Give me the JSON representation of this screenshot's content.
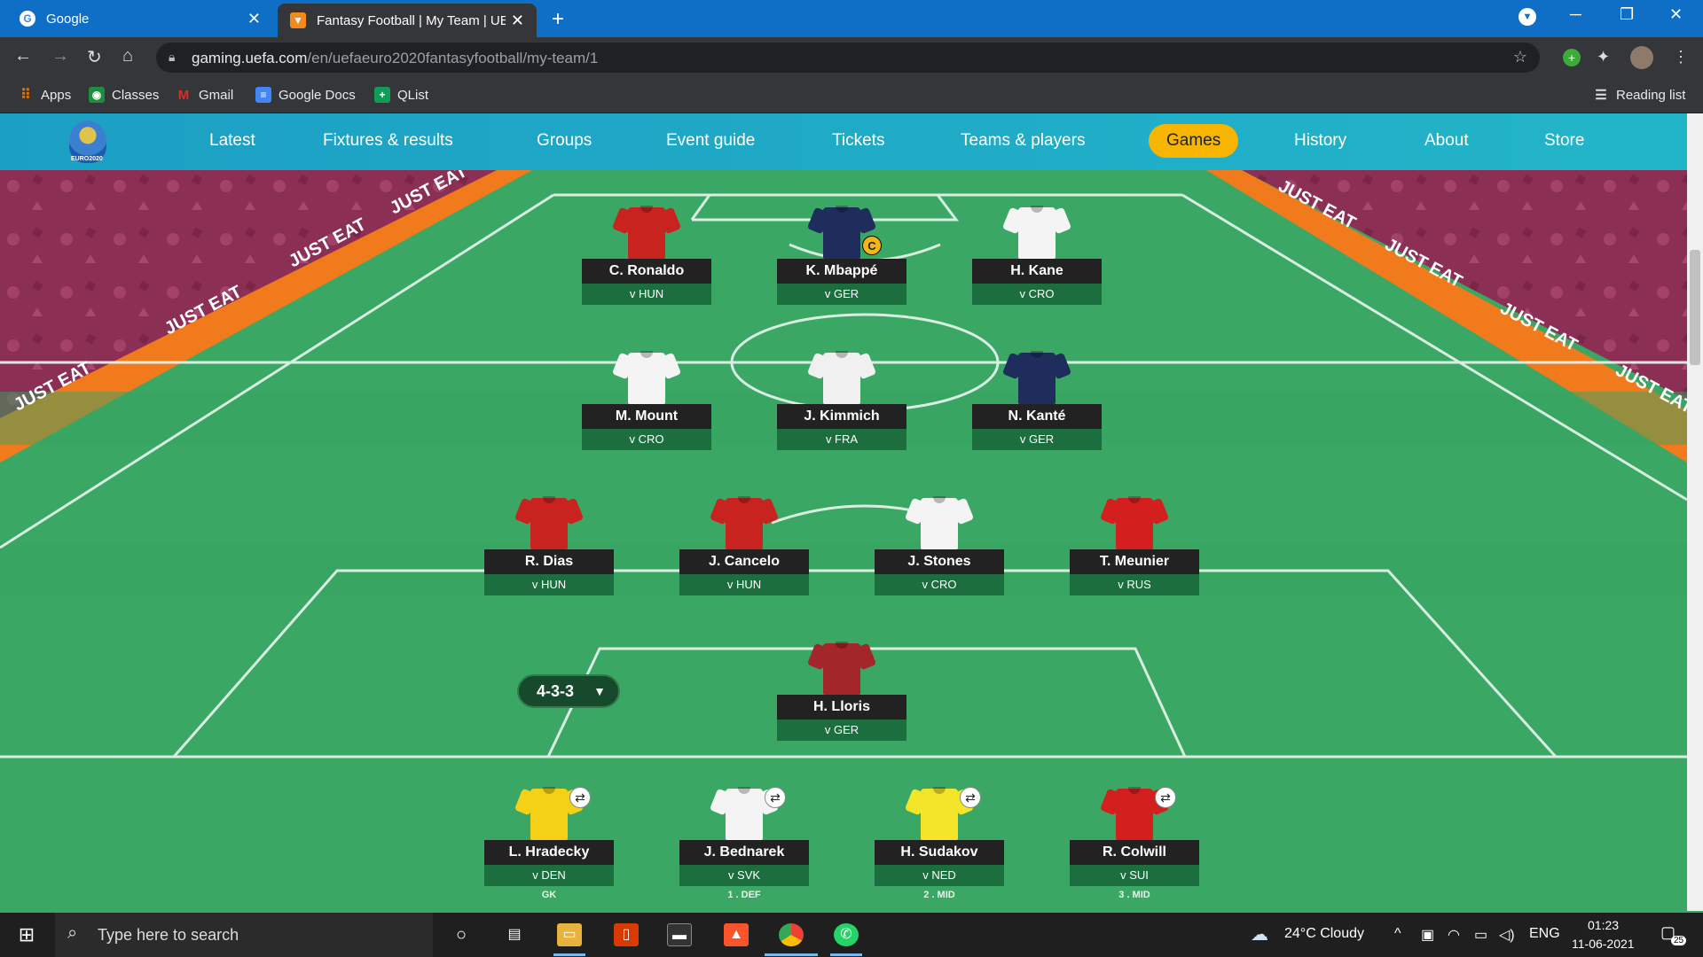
{
  "browser": {
    "tabs": [
      {
        "title": "Google",
        "active": false
      },
      {
        "title": "Fantasy Football | My Team | UEFA",
        "active": true
      }
    ],
    "new_tab_symbol": "+",
    "url_host": "gaming.uefa.com",
    "url_path": "/en/uefaeuro2020fantasyfootball/my-team/1",
    "bookmarks": [
      {
        "label": "Apps",
        "icon": "apps-grid-icon",
        "color": "#e8710a"
      },
      {
        "label": "Classes",
        "icon": "classes-icon",
        "color": "#1e8e3e"
      },
      {
        "label": "Gmail",
        "icon": "gmail-icon",
        "color": "#d93025"
      },
      {
        "label": "Google Docs",
        "icon": "docs-icon",
        "color": "#4285f4"
      },
      {
        "label": "QList",
        "icon": "qlist-icon",
        "color": "#0f9d58"
      }
    ],
    "reading_list": "Reading list"
  },
  "site": {
    "logo_text": "EURO2020",
    "nav": [
      "Latest",
      "Fixtures & results",
      "Groups",
      "Event guide",
      "Tickets",
      "Teams & players",
      "Games",
      "History",
      "About",
      "Store"
    ],
    "active_nav": "Games"
  },
  "team": {
    "formation": "4-3-3",
    "captain_mark": "C",
    "forwards": [
      {
        "name": "C. Ronaldo",
        "fixture": "v HUN",
        "shirt": "#c8231f",
        "sleeve": "#c8231f"
      },
      {
        "name": "K. Mbappé",
        "fixture": "v GER",
        "shirt": "#1f2d5c",
        "sleeve": "#1f2d5c",
        "captain": true
      },
      {
        "name": "H. Kane",
        "fixture": "v CRO",
        "shirt": "#f4f4f4",
        "sleeve": "#f4f4f4"
      }
    ],
    "midfielders": [
      {
        "name": "M. Mount",
        "fixture": "v CRO",
        "shirt": "#f4f4f4",
        "sleeve": "#f4f4f4"
      },
      {
        "name": "J. Kimmich",
        "fixture": "v FRA",
        "shirt": "#f0f0f0",
        "sleeve": "#f0f0f0"
      },
      {
        "name": "N. Kanté",
        "fixture": "v GER",
        "shirt": "#1f2d5c",
        "sleeve": "#1f2d5c"
      }
    ],
    "defenders": [
      {
        "name": "R. Dias",
        "fixture": "v HUN",
        "shirt": "#c8231f",
        "sleeve": "#c8231f"
      },
      {
        "name": "J. Cancelo",
        "fixture": "v HUN",
        "shirt": "#c8231f",
        "sleeve": "#c8231f"
      },
      {
        "name": "J. Stones",
        "fixture": "v CRO",
        "shirt": "#f4f4f4",
        "sleeve": "#f4f4f4"
      },
      {
        "name": "T. Meunier",
        "fixture": "v RUS",
        "shirt": "#d41f1f",
        "sleeve": "#d41f1f"
      }
    ],
    "goalkeeper": {
      "name": "H. Lloris",
      "fixture": "v GER",
      "shirt": "#a3262a",
      "sleeve": "#a3262a"
    },
    "bench": [
      {
        "name": "L. Hradecky",
        "fixture": "v DEN",
        "position": "GK",
        "shirt": "#f4d117",
        "sleeve": "#f4d117"
      },
      {
        "name": "J. Bednarek",
        "fixture": "v SVK",
        "position": "1 . DEF",
        "shirt": "#f4f4f4",
        "sleeve": "#f4f4f4"
      },
      {
        "name": "H. Sudakov",
        "fixture": "v NED",
        "position": "2 . MID",
        "shirt": "#f4e52a",
        "sleeve": "#f4e52a"
      },
      {
        "name": "R. Colwill",
        "fixture": "v SUI",
        "position": "3 . MID",
        "shirt": "#d41f1f",
        "sleeve": "#d41f1f"
      }
    ]
  },
  "banner_text": "JUST EAT",
  "taskbar": {
    "search_placeholder": "Type here to search",
    "weather": "24°C  Cloudy",
    "lang": "ENG",
    "time": "01:23",
    "date": "11-06-2021",
    "notif_count": "25"
  },
  "colors": {
    "chrome_blue": "#0f6fc6",
    "nav_teal": "#1fa8c6",
    "games_highlight": "#f7b500",
    "pitch_green": "#3aa864",
    "banner_orange": "#f07a1c"
  }
}
